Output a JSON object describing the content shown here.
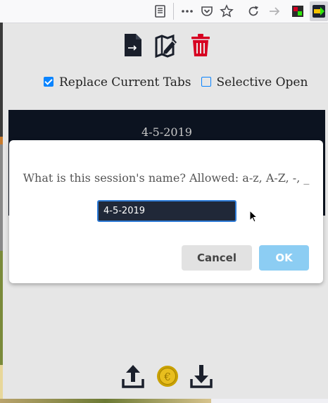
{
  "browser": {
    "icons": [
      "reader-view-icon",
      "more-icon",
      "pocket-icon",
      "bookmark-star-icon",
      "reload-icon",
      "forward-icon",
      "extension-icon",
      "session-extension-icon"
    ]
  },
  "popup": {
    "toolbar_icons": [
      "export-file-icon",
      "edit-map-icon",
      "trash-icon"
    ],
    "options": {
      "replace_current_tabs": {
        "label": "Replace Current Tabs",
        "checked": true
      },
      "selective_open": {
        "label": "Selective Open",
        "checked": false
      }
    },
    "sessions": [
      "4-5-2019"
    ],
    "bottom_icons": [
      "upload-icon",
      "donate-coin-icon",
      "download-icon"
    ]
  },
  "dialog": {
    "question": "What is this session's name? Allowed: a-z, A-Z, -, _",
    "input_value": "4-5-2019",
    "cancel_label": "Cancel",
    "ok_label": "OK"
  },
  "colors": {
    "accent": "#0a84ff",
    "trash": "#d70022",
    "session_bg": "#0c1320",
    "ok_button": "#8ccdf3"
  }
}
